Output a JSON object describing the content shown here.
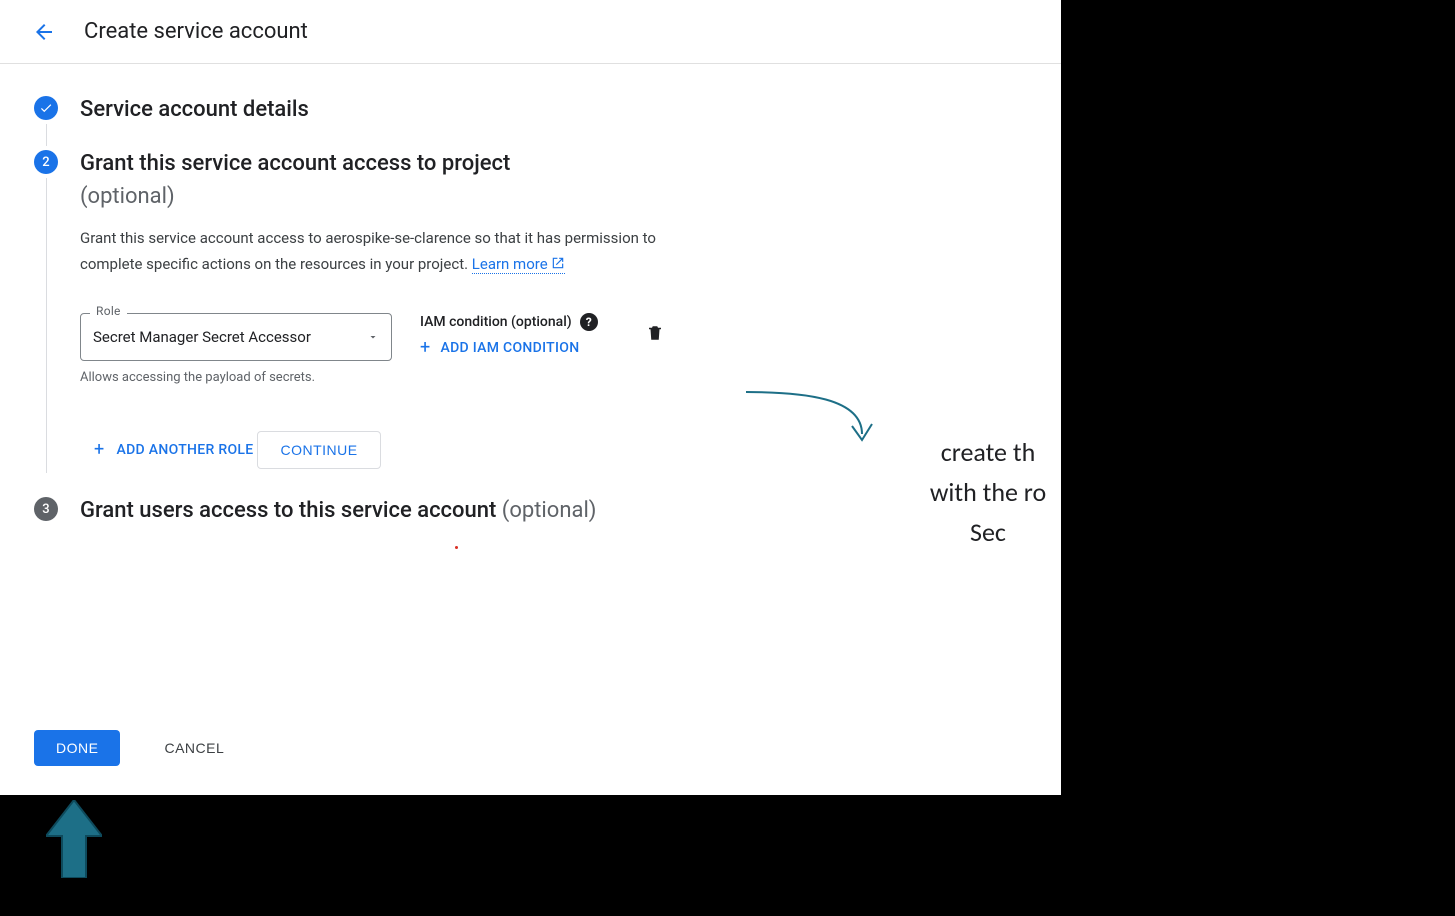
{
  "header": {
    "title": "Create service account"
  },
  "step1": {
    "title": "Service account details"
  },
  "step2": {
    "number": "2",
    "title": "Grant this service account access to project",
    "optional": "(optional)",
    "desc_prefix": "Grant this service account access to aerospike-se-clarence so that it has permission to complete specific actions on the resources in your project. ",
    "learn_more": "Learn more",
    "role_label": "Role",
    "role_value": "Secret Manager Secret Accessor",
    "role_helper": "Allows accessing the payload of secrets.",
    "iam_label": "IAM condition (optional)",
    "add_iam": "ADD IAM CONDITION",
    "add_role": "ADD ANOTHER ROLE",
    "continue": "CONTINUE"
  },
  "step3": {
    "number": "3",
    "title": "Grant users access to this service account",
    "optional": "(optional)"
  },
  "actions": {
    "done": "DONE",
    "cancel": "CANCEL"
  },
  "annotation": {
    "line1": "create th",
    "line2": "with the ro",
    "line3": "Sec"
  }
}
